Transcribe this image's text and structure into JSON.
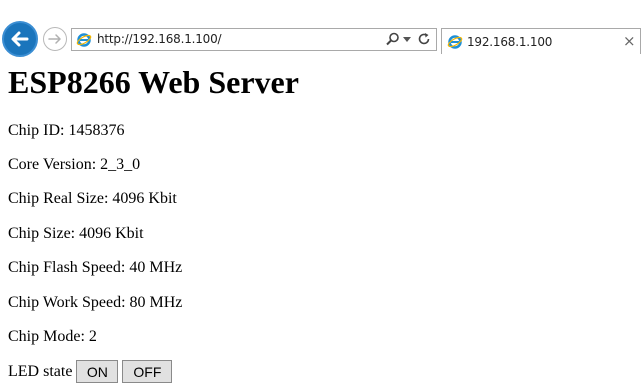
{
  "browser": {
    "url": "http://192.168.1.100/",
    "tab_title": "192.168.1.100",
    "tab_close": "×"
  },
  "page": {
    "title": "ESP8266 Web Server",
    "info": [
      "Chip ID: 1458376",
      "Core Version: 2_3_0",
      "Chip Real Size: 4096 Kbit",
      "Chip Size: 4096 Kbit",
      "Chip Flash Speed: 40 MHz",
      "Chip Work Speed: 80 MHz",
      "Chip Mode: 2"
    ],
    "led_label": "LED state",
    "on_label": "ON",
    "off_label": "OFF"
  },
  "colors": {
    "back_button": "#1b75bc",
    "ie_icon": "#1e8fd6"
  },
  "icons": [
    "back-arrow-icon",
    "forward-arrow-icon",
    "internet-explorer-icon",
    "search-icon",
    "dropdown-icon",
    "refresh-icon",
    "close-icon"
  ]
}
